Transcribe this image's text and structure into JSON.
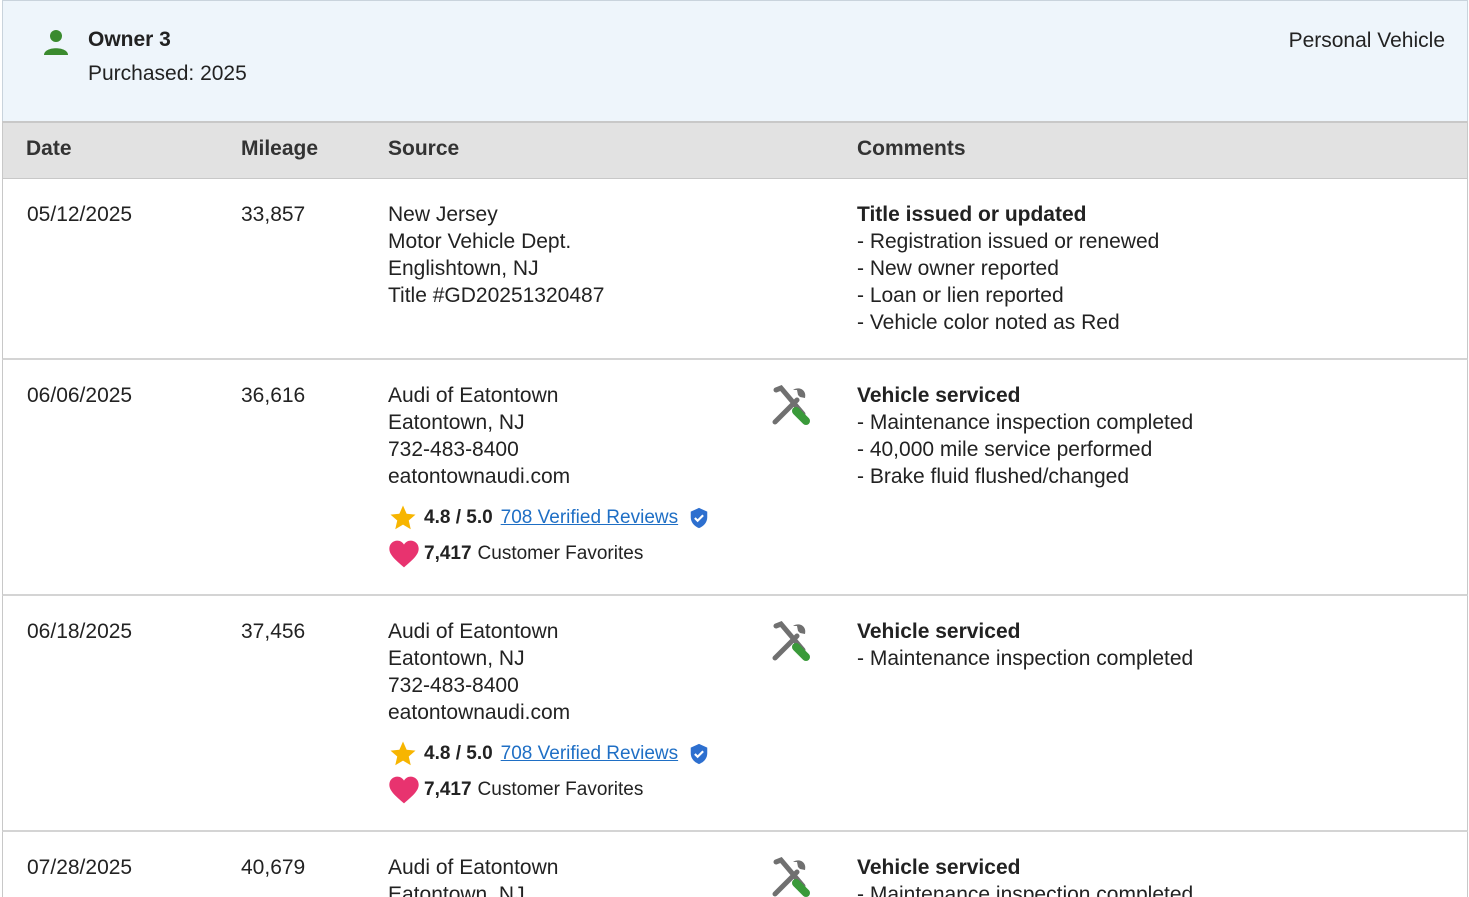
{
  "owner": {
    "name": "Owner 3",
    "purchased": "Purchased: 2025",
    "type": "Personal Vehicle"
  },
  "columns": {
    "date": "Date",
    "mileage": "Mileage",
    "source": "Source",
    "comments": "Comments"
  },
  "rows": [
    {
      "date": "05/12/2025",
      "mileage": "33,857",
      "source": [
        "New Jersey",
        "Motor Vehicle Dept.",
        "Englishtown, NJ",
        "Title #GD20251320487"
      ],
      "comment_title": "Title issued or updated",
      "comments": [
        "- Registration issued or renewed",
        "- New owner reported",
        "- Loan or lien reported",
        "- Vehicle color noted as Red"
      ]
    },
    {
      "date": "06/06/2025",
      "mileage": "36,616",
      "source": [
        "Audi of Eatontown",
        "Eatontown, NJ",
        "732-483-8400",
        "eatontownaudi.com"
      ],
      "rating": "4.8 / 5.0",
      "reviews": "708 Verified Reviews",
      "favorites_count": "7,417",
      "favorites_label": "Customer Favorites",
      "icon": "service-tools-icon",
      "comment_title": "Vehicle serviced",
      "comments": [
        "- Maintenance inspection completed",
        "- 40,000 mile service performed",
        "- Brake fluid flushed/changed"
      ]
    },
    {
      "date": "06/18/2025",
      "mileage": "37,456",
      "source": [
        "Audi of Eatontown",
        "Eatontown, NJ",
        "732-483-8400",
        "eatontownaudi.com"
      ],
      "rating": "4.8 / 5.0",
      "reviews": "708 Verified Reviews",
      "favorites_count": "7,417",
      "favorites_label": "Customer Favorites",
      "icon": "service-tools-icon",
      "comment_title": "Vehicle serviced",
      "comments": [
        "- Maintenance inspection completed"
      ]
    },
    {
      "date": "07/28/2025",
      "mileage": "40,679",
      "source": [
        "Audi of Eatontown",
        "Eatontown, NJ"
      ],
      "icon": "service-tools-icon",
      "comment_title": "Vehicle serviced",
      "comments": [
        "- Maintenance inspection completed"
      ]
    }
  ],
  "colors": {
    "owner_icon": "#3a8a2e",
    "header_bg": "#eef5fb",
    "table_header_bg": "#e2e2e2",
    "link": "#1f6fc5",
    "star": "#f7b500",
    "heart": "#e8336f",
    "verified_badge": "#2d6fcf",
    "tool_gray": "#707070",
    "tool_green": "#3a9a3a"
  }
}
